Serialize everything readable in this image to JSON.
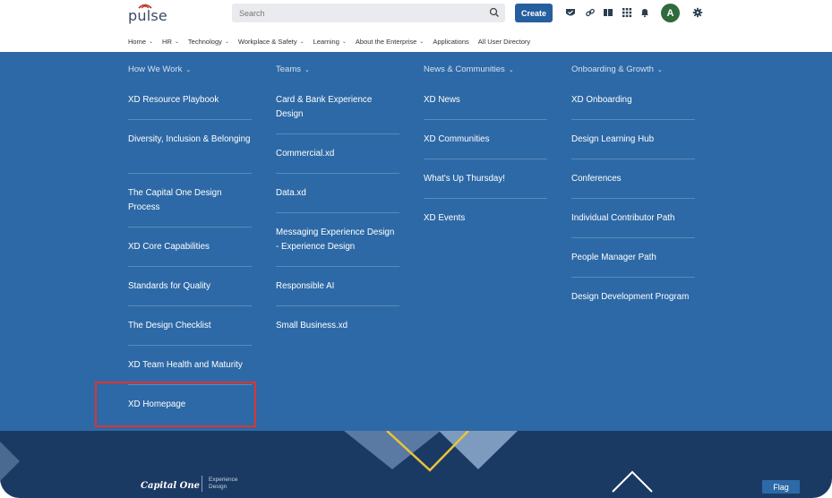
{
  "header": {
    "logo": "pulse",
    "search": {
      "placeholder": "Search"
    },
    "create_label": "Create",
    "avatar_initial": "A",
    "tools": [
      "check-shield-icon",
      "link-icon",
      "bookmark-icon",
      "grid-icon",
      "bell-icon",
      "gear-icon"
    ]
  },
  "nav": {
    "items": [
      {
        "label": "Home"
      },
      {
        "label": "HR"
      },
      {
        "label": "Technology"
      },
      {
        "label": "Workplace & Safety"
      },
      {
        "label": "Learning"
      },
      {
        "label": "About the Enterprise"
      },
      {
        "label": "Applications"
      },
      {
        "label": "All User Directory"
      }
    ]
  },
  "menu": {
    "columns": [
      {
        "heading": "How We Work",
        "links": [
          "XD Resource Playbook",
          "Diversity, Inclusion & Belonging",
          "The Capital One Design Process",
          "XD Core Capabilities",
          "Standards for Quality",
          "The Design Checklist",
          "XD Team Health and Maturity",
          "XD Homepage"
        ]
      },
      {
        "heading": "Teams",
        "links": [
          "Card & Bank Experience Design",
          "Commercial.xd",
          "Data.xd",
          "Messaging Experience Design - Experience Design",
          "Responsible AI",
          "Small Business.xd"
        ]
      },
      {
        "heading": "News & Communities",
        "links": [
          "XD News",
          "XD Communities",
          "What's Up Thursday!",
          "XD Events"
        ]
      },
      {
        "heading": "Onboarding & Growth",
        "links": [
          "XD Onboarding",
          "Design Learning Hub",
          "Conferences",
          "Individual Contributor Path",
          "People Manager Path",
          "Design Development Program"
        ]
      }
    ]
  },
  "footer": {
    "brand": "Capital One",
    "brand_sub_1": "Experience",
    "brand_sub_2": "Design",
    "flag_label": "Flag"
  },
  "colors": {
    "menu_bg": "#2d69a6",
    "footer_bg": "#1b3a63",
    "create_btn": "#255f9e",
    "highlight": "#e0332d",
    "avatar": "#2f6b3d"
  }
}
